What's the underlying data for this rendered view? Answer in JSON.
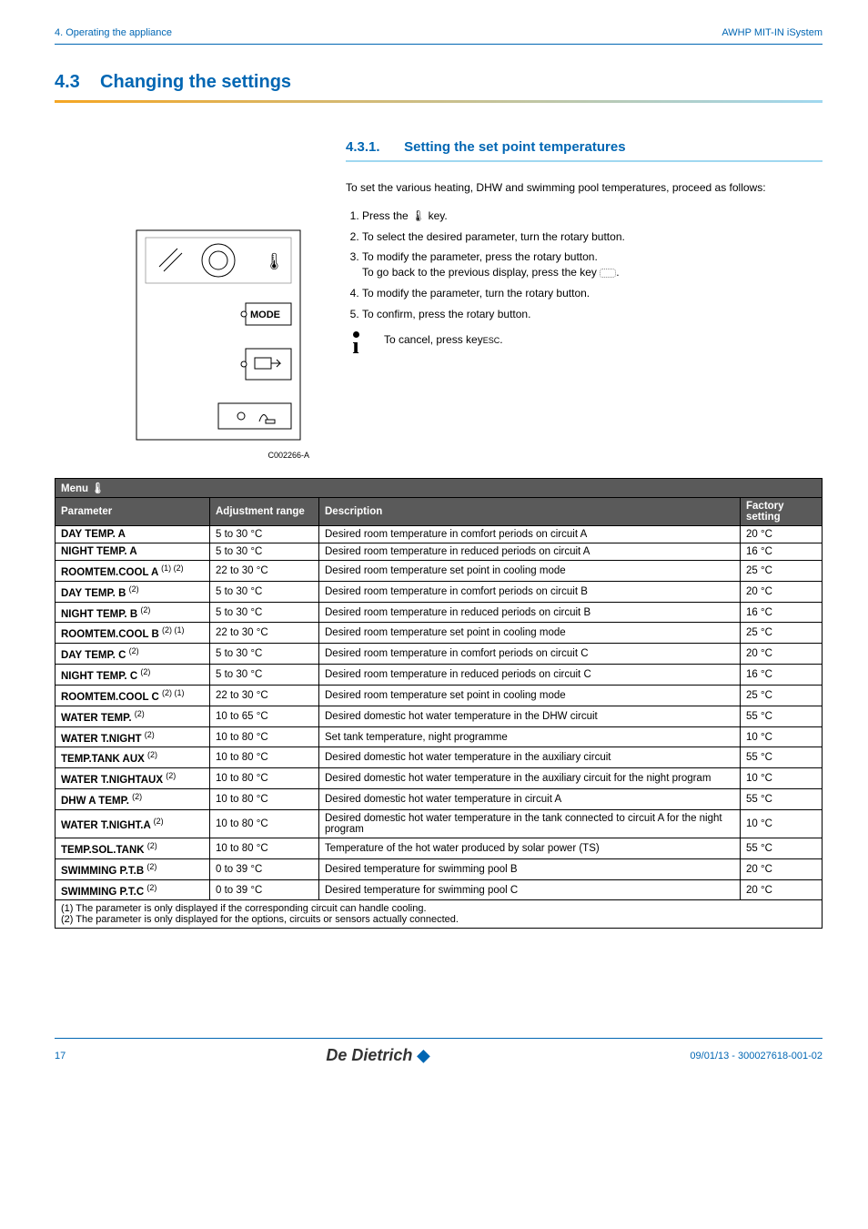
{
  "header": {
    "breadcrumb": "4.  Operating the appliance",
    "product": "AWHP MIT-IN iSystem"
  },
  "section": {
    "number": "4.3",
    "title": "Changing the settings"
  },
  "subsection": {
    "number": "4.3.1.",
    "title": "Setting the set point temperatures",
    "intro": "To set the various heating, DHW and swimming pool temperatures, proceed as follows:",
    "steps": [
      "Press the 🌡 key.",
      "To select the desired parameter, turn the rotary button.",
      "To modify the parameter, press the rotary button.\nTo go back to the previous display, press the key ⌐.",
      "To modify the parameter, turn the rotary button.",
      "To confirm, press the rotary button."
    ],
    "cancel_note": "To cancel, press key",
    "cancel_key": "ESC"
  },
  "device": {
    "mode_label": "MODE",
    "caption": "C002266-A"
  },
  "table": {
    "menu_label": "Menu 🌡",
    "headers": {
      "param": "Parameter",
      "range": "Adjustment range",
      "desc": "Description",
      "factory": "Factory setting"
    },
    "rows": [
      {
        "name": "DAY TEMP. A",
        "sup": "",
        "range": "5 to 30 °C",
        "desc": "Desired room temperature in comfort periods on circuit A",
        "factory": "20 °C"
      },
      {
        "name": "NIGHT TEMP. A",
        "sup": "",
        "range": "5 to 30 °C",
        "desc": "Desired room temperature in reduced periods on circuit A",
        "factory": "16 °C"
      },
      {
        "name": "ROOMTEM.COOL A",
        "sup": "(1) (2)",
        "range": "22 to 30 °C",
        "desc": "Desired room temperature set point in cooling mode",
        "factory": "25 °C"
      },
      {
        "name": "DAY TEMP. B",
        "sup": "(2)",
        "range": "5 to 30 °C",
        "desc": "Desired room temperature in comfort periods on circuit B",
        "factory": "20 °C"
      },
      {
        "name": "NIGHT TEMP. B",
        "sup": "(2)",
        "range": "5 to 30 °C",
        "desc": "Desired room temperature in reduced periods on circuit B",
        "factory": "16 °C"
      },
      {
        "name": "ROOMTEM.COOL B",
        "sup": "(2) (1)",
        "range": "22 to 30 °C",
        "desc": "Desired room temperature set point in cooling mode",
        "factory": "25 °C"
      },
      {
        "name": "DAY TEMP. C",
        "sup": "(2)",
        "range": "5 to 30 °C",
        "desc": "Desired room temperature in comfort periods on circuit C",
        "factory": "20 °C"
      },
      {
        "name": "NIGHT TEMP. C",
        "sup": "(2)",
        "range": "5 to 30 °C",
        "desc": "Desired room temperature in reduced periods on circuit C",
        "factory": "16 °C"
      },
      {
        "name": "ROOMTEM.COOL C",
        "sup": "(2) (1)",
        "range": "22 to 30 °C",
        "desc": "Desired room temperature set point in cooling mode",
        "factory": "25 °C"
      },
      {
        "name": "WATER TEMP.",
        "sup": "(2)",
        "range": "10 to 65 °C",
        "desc": "Desired domestic hot water temperature in the DHW circuit",
        "factory": "55 °C"
      },
      {
        "name": "WATER T.NIGHT",
        "sup": "(2)",
        "range": "10 to 80 °C",
        "desc": "Set tank temperature, night programme",
        "factory": "10 °C"
      },
      {
        "name": "TEMP.TANK AUX",
        "sup": "(2)",
        "range": "10 to 80 °C",
        "desc": "Desired domestic hot water temperature in the auxiliary circuit",
        "factory": "55 °C"
      },
      {
        "name": "WATER T.NIGHTAUX",
        "sup": "(2)",
        "range": "10 to 80 °C",
        "desc": "Desired domestic hot water temperature in the auxiliary circuit for the night program",
        "factory": "10 °C"
      },
      {
        "name": "DHW A TEMP.",
        "sup": "(2)",
        "range": "10 to 80 °C",
        "desc": "Desired domestic hot water temperature in circuit A",
        "factory": "55 °C"
      },
      {
        "name": "WATER T.NIGHT.A",
        "sup": "(2)",
        "range": "10 to 80 °C",
        "desc": "Desired domestic hot water temperature in the tank connected to circuit A for the night program",
        "factory": "10 °C"
      },
      {
        "name": "TEMP.SOL.TANK",
        "sup": "(2)",
        "range": "10 to 80 °C",
        "desc": "Temperature of the hot water produced by solar power (TS)",
        "factory": "55 °C"
      },
      {
        "name": "SWIMMING P.T.B",
        "sup": "(2)",
        "range": "0 to 39 °C",
        "desc": "Desired temperature for swimming pool B",
        "factory": "20 °C"
      },
      {
        "name": "SWIMMING P.T.C",
        "sup": "(2)",
        "range": "0 to 39 °C",
        "desc": "Desired temperature for swimming pool C",
        "factory": "20 °C"
      }
    ],
    "footnotes": [
      "(1)  The parameter is only displayed if the corresponding circuit can handle cooling.",
      "(2)  The parameter is only displayed for the options, circuits or sensors actually connected."
    ]
  },
  "footer": {
    "page": "17",
    "logo_a": "De Dietrich",
    "docref": "09/01/13 - 300027618-001-02"
  }
}
